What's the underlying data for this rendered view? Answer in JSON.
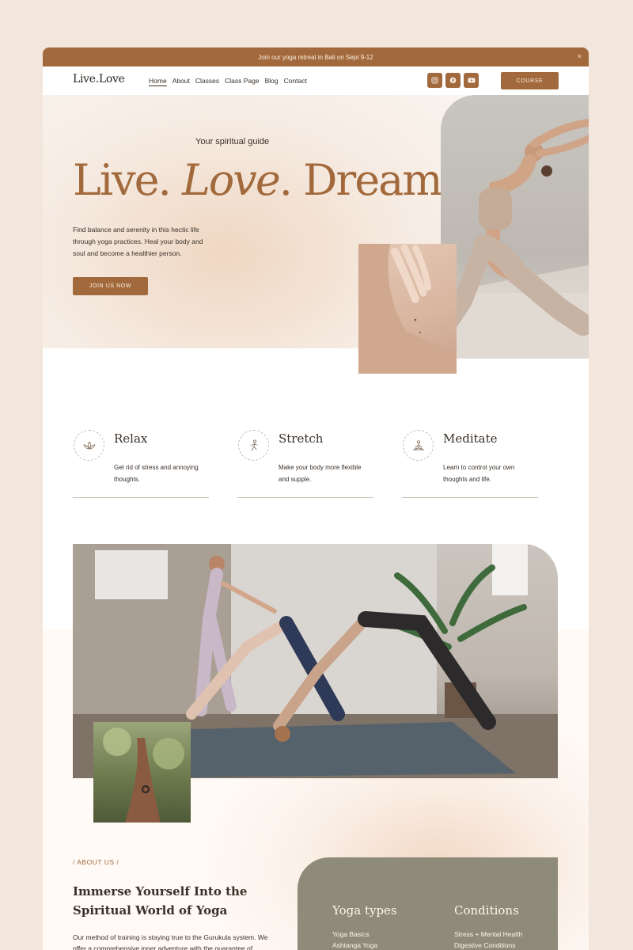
{
  "announcement": {
    "text": "Join our yoga retreat in Bali on Sept 9-12",
    "close": "×"
  },
  "header": {
    "logo": "Live.Love",
    "nav": [
      "Home",
      "About",
      "Classes",
      "Class Page",
      "Blog",
      "Contact"
    ],
    "socials": [
      "instagram-icon",
      "pinterest-icon",
      "youtube-icon"
    ],
    "cta": "COURSE"
  },
  "hero": {
    "tagline": "Your spiritual guide",
    "title_a": "Live. ",
    "title_b": "Love",
    "title_c": ". Dream",
    "description": "Find balance and serenity in this hectic life through yoga practices. Heal your body and soul and become a healthier person.",
    "cta": "JOIN US NOW"
  },
  "features": [
    {
      "title": "Relax",
      "text": "Get rid of stress and annoying thoughts.",
      "icon": "lotus-icon"
    },
    {
      "title": "Stretch",
      "text": "Make your body more flexible and supple.",
      "icon": "stretch-figure-icon"
    },
    {
      "title": "Meditate",
      "text": "Learn to control your own thoughts and life.",
      "icon": "meditation-icon"
    }
  ],
  "about": {
    "kicker": "/ ABOUT US /",
    "title": "Immerse Yourself Into the Spiritual World of Yoga",
    "text": "Our method of training is staying true to the Gurukula system. We offer a comprehensive inner adventure with the guarantee of"
  },
  "types": {
    "yoga_types": {
      "heading": "Yoga types",
      "items": [
        "Yoga Basics",
        "Ashtanga Yoga"
      ]
    },
    "conditions": {
      "heading": "Conditions",
      "items": [
        "Stress + Mental Health",
        "Digestive Conditions"
      ]
    }
  },
  "colors": {
    "accent": "#a26a3c",
    "card": "#8e8b7a",
    "page_bg": "#f3e6dc"
  }
}
